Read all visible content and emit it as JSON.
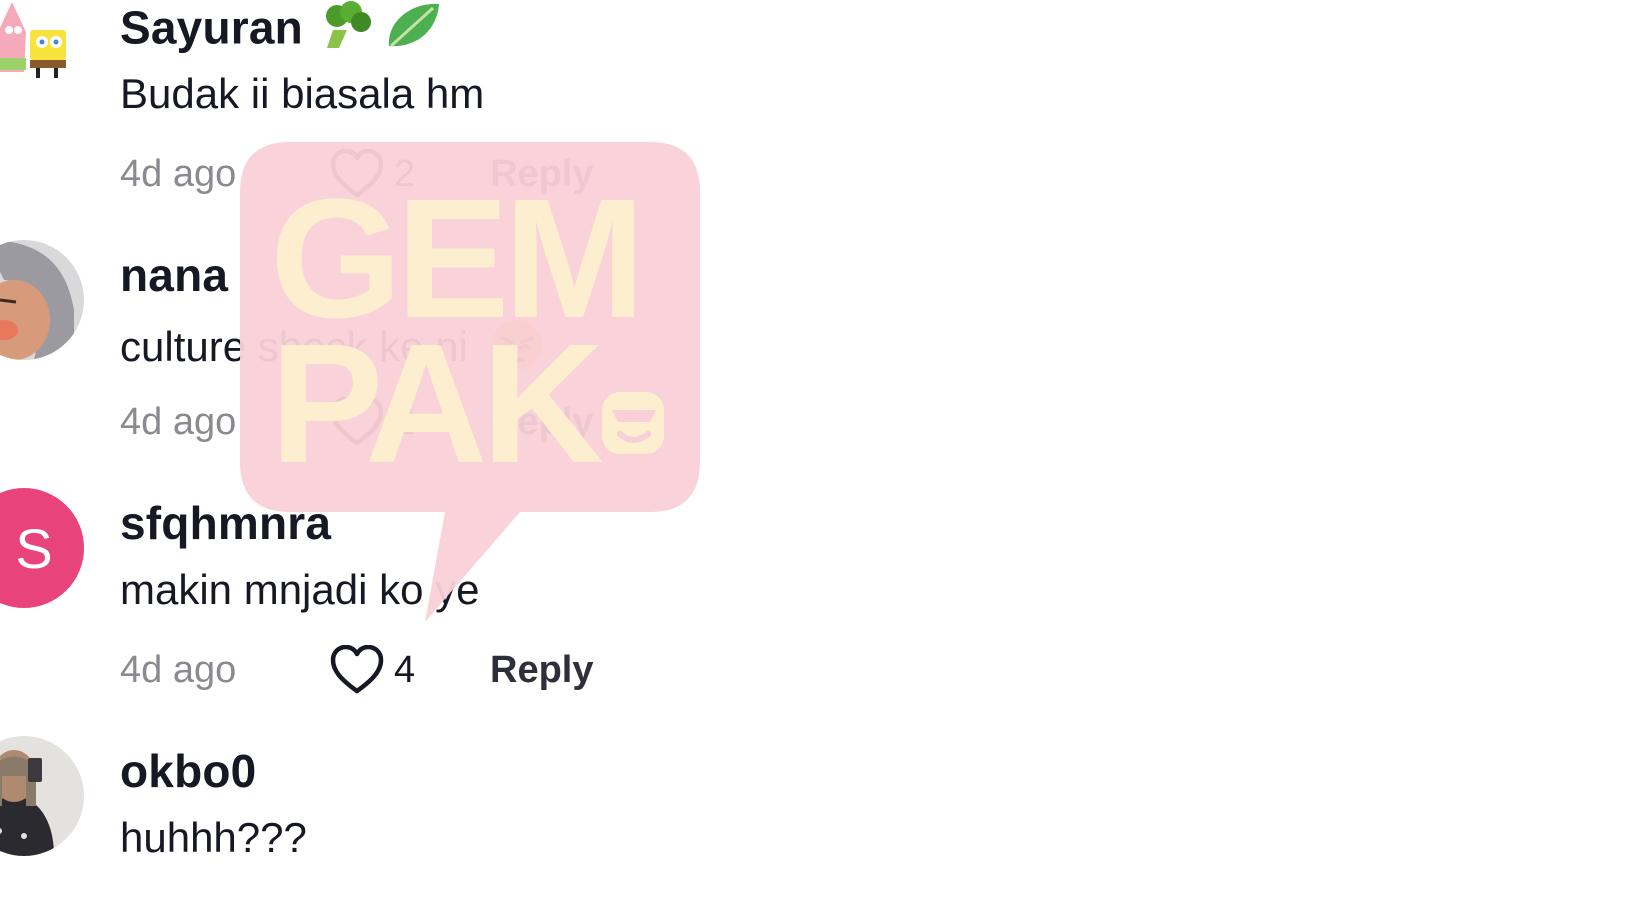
{
  "comments": [
    {
      "username": "Sayuran",
      "username_emoji": "broccoli-leafy-green-emoji",
      "text": "Budak ii biasala hm",
      "time": "4d ago",
      "likes": "2",
      "reply": "Reply",
      "avatar": "patrick-spongebob-avatar"
    },
    {
      "username": "nana",
      "text": "culture shock ke ni",
      "text_emoji": "weary-face-emoji",
      "time": "4d ago",
      "likes": "2",
      "reply": "Reply",
      "avatar": "photo-avatar"
    },
    {
      "username": "sfqhmnra",
      "text": "makin mnjadi ko ye",
      "time": "4d ago",
      "likes": "4",
      "reply": "Reply",
      "avatar_letter": "S",
      "avatar_color": "#e8437a"
    },
    {
      "username": "okbo0",
      "text": "huhhh???",
      "avatar": "photo-avatar"
    }
  ],
  "watermark": {
    "text_line1": "GEM",
    "text_line2": "PAK",
    "bubble_color": "#f9d0d8",
    "text_color": "#fdeed0"
  },
  "colors": {
    "username": "#161823",
    "time": "#8a8b91",
    "accent_pink": "#e8437a"
  }
}
